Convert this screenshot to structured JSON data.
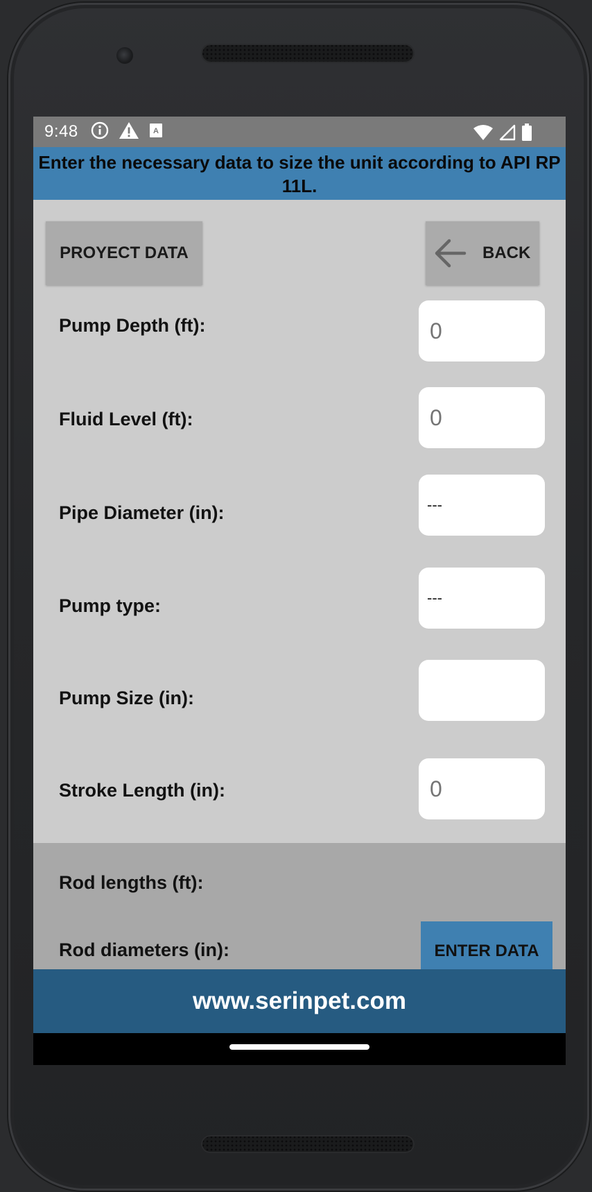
{
  "status": {
    "time": "9:48",
    "icons_left": [
      "info-icon",
      "warning-icon",
      "keyboard-a-icon"
    ],
    "icons_right": [
      "wifi-icon",
      "signal-icon",
      "battery-icon"
    ]
  },
  "header": {
    "title": "Enter the necessary data to size the unit according to API RP 11L."
  },
  "buttons": {
    "project_data": "PROYECT DATA",
    "back": "BACK",
    "enter_data": "ENTER DATA"
  },
  "fields": [
    {
      "label": "Pump Depth (ft):",
      "value": "",
      "placeholder": "0"
    },
    {
      "label": "Fluid Level (ft):",
      "value": "",
      "placeholder": "0"
    },
    {
      "label": "Pipe Diameter (in):",
      "value": "---"
    },
    {
      "label": "Pump type:",
      "value": "---"
    },
    {
      "label": "Pump Size (in):",
      "value": ""
    },
    {
      "label": "Stroke Length (in):",
      "value": "",
      "placeholder": "0"
    }
  ],
  "rods": {
    "lengths_label": "Rod lengths  (ft):",
    "diameters_label": "Rod diameters (in):"
  },
  "footer": {
    "url": "www.serinpet.com"
  },
  "colors": {
    "header_blue": "#3f80b1",
    "footer_blue": "#265b81",
    "screen_bg": "#cccccc",
    "button_gray": "#ababab"
  }
}
